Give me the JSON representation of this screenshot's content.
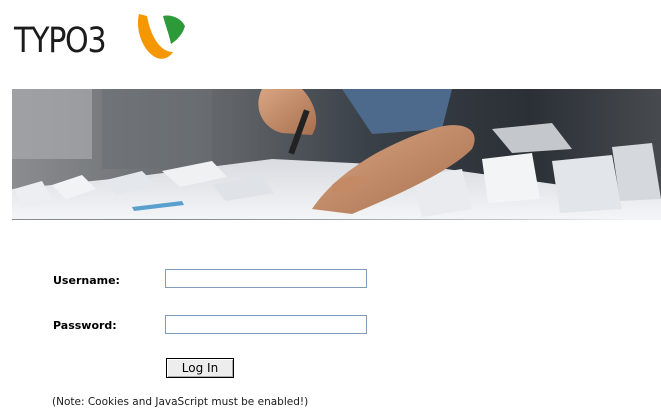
{
  "logo": {
    "text": "TYPO3",
    "colors": {
      "orange": "#f49700",
      "green": "#2d9a3a",
      "text": "#1c1c1c"
    }
  },
  "banner": {
    "icon": "banner-photo-hands-architecture-model"
  },
  "form": {
    "username_label": "Username:",
    "username_value": "",
    "password_label": "Password:",
    "password_value": "",
    "login_button_label": "Log In"
  },
  "note": "(Note: Cookies and JavaScript must be enabled!)"
}
